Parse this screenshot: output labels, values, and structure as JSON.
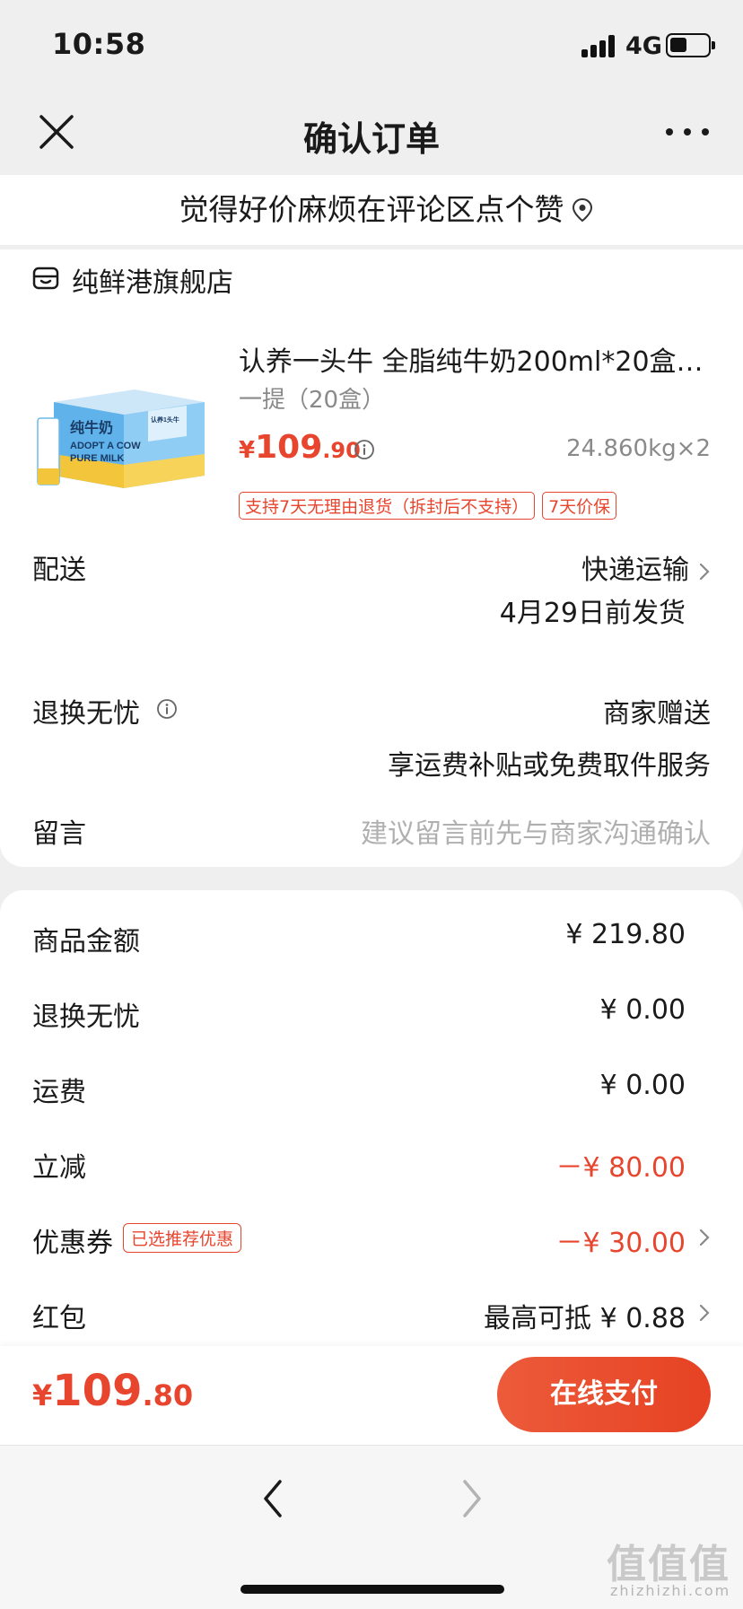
{
  "status_bar": {
    "time": "10:58",
    "network": "4G",
    "battery_level": 0.45,
    "icons": [
      "signal-icon",
      "battery-icon"
    ]
  },
  "nav": {
    "title": "确认订单",
    "close_icon": "close-icon",
    "more_icon": "more-icon"
  },
  "banner": {
    "text": "觉得好价麻烦在评论区点个赞",
    "icon": "location-pin-icon"
  },
  "store": {
    "name": "纯鲜港旗舰店",
    "icon": "store-icon"
  },
  "product": {
    "title": "认养一头牛 全脂纯牛奶200ml*20盒…",
    "spec": "一提（20盒）",
    "price_currency": "¥",
    "price_int": "109",
    "price_dec": ".90",
    "weight_qty": "24.860kg×2",
    "tags": [
      "支持7天无理由退货（拆封后不支持）",
      "7天价保"
    ],
    "image_text": {
      "brand": "认养1头牛",
      "line1": "纯牛奶",
      "line2": "ADOPT A COW",
      "line3": "PURE MILK"
    }
  },
  "delivery": {
    "label": "配送",
    "method": "快递运输",
    "date": "4月29日前发货"
  },
  "worry_free": {
    "label": "退换无忧",
    "value": "商家赠送",
    "desc": "享运费补贴或免费取件服务"
  },
  "message": {
    "label": "留言",
    "placeholder": "建议留言前先与商家沟通确认"
  },
  "summary": [
    {
      "label": "商品金额",
      "value": "¥ 219.80"
    },
    {
      "label": "退换无忧",
      "value": "¥ 0.00"
    },
    {
      "label": "运费",
      "value": "¥ 0.00"
    },
    {
      "label": "立减",
      "value": "－¥ 80.00"
    },
    {
      "label": "优惠券",
      "tag": "已选推荐优惠",
      "value": "－¥ 30.00"
    },
    {
      "label": "红包",
      "value": "最高可抵 ¥ 0.88"
    }
  ],
  "pay": {
    "currency": "¥",
    "total_int": "109",
    "total_dec": ".80",
    "button": "在线支付"
  },
  "browser": {
    "back_icon": "back-arrow-icon",
    "forward_icon": "forward-arrow-icon"
  },
  "watermark": {
    "text": "值值值",
    "url": "zhizhizhi.com"
  },
  "colors": {
    "accent": "#e8452e",
    "page_bg": "#efefef",
    "muted": "#8a8a8a"
  }
}
